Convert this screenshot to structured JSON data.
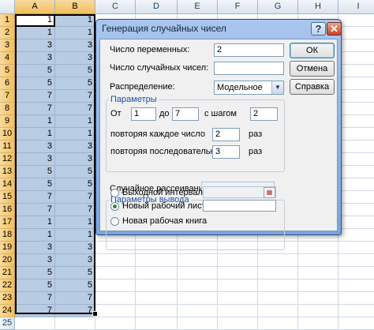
{
  "sheet": {
    "columns": [
      {
        "label": "A",
        "width": 51,
        "selected": true
      },
      {
        "label": "B",
        "width": 51,
        "selected": true
      },
      {
        "label": "C",
        "width": 51,
        "selected": false
      },
      {
        "label": "D",
        "width": 53,
        "selected": false
      },
      {
        "label": "E",
        "width": 51,
        "selected": false
      },
      {
        "label": "F",
        "width": 51,
        "selected": false
      },
      {
        "label": "G",
        "width": 51,
        "selected": false
      },
      {
        "label": "H",
        "width": 51,
        "selected": false
      },
      {
        "label": "I",
        "width": 51,
        "selected": false
      }
    ],
    "rows": [
      "1",
      "2",
      "3",
      "4",
      "5",
      "6",
      "7",
      "8",
      "9",
      "10",
      "11",
      "12",
      "13",
      "14",
      "15",
      "16",
      "17",
      "18",
      "19",
      "20",
      "21",
      "22",
      "23",
      "24",
      "25"
    ],
    "col_a": [
      "1",
      "1",
      "3",
      "3",
      "5",
      "5",
      "7",
      "7",
      "1",
      "1",
      "3",
      "3",
      "5",
      "5",
      "7",
      "7",
      "1",
      "1",
      "3",
      "3",
      "5",
      "5",
      "7",
      "7"
    ],
    "col_b": [
      "1",
      "1",
      "3",
      "3",
      "5",
      "5",
      "7",
      "7",
      "1",
      "1",
      "3",
      "3",
      "5",
      "5",
      "7",
      "7",
      "1",
      "1",
      "3",
      "3",
      "5",
      "5",
      "7",
      "7"
    ],
    "selection_color": "#b8cce4",
    "header_selected_color": "#f1c05a"
  },
  "dialog": {
    "title": "Генерация случайных чисел",
    "help_glyph": "?",
    "close_glyph": "✕",
    "num_variables_label": "Число переменных:",
    "num_variables_value": "2",
    "num_random_label": "Число случайных чисел:",
    "num_random_value": "",
    "distribution_label": "Распределение:",
    "distribution_value": "Модельное",
    "ok_label": "ОК",
    "cancel_label": "Отмена",
    "help_label": "Справка",
    "params_title": "Параметры",
    "from_label": "От",
    "from_value": "1",
    "to_label": "до",
    "to_value": "7",
    "step_label": "с шагом",
    "step_value": "2",
    "repeat_each_label": "повторяя каждое число",
    "repeat_each_value": "2",
    "repeat_each_unit": "раз",
    "repeat_seq_label": "повторяя последовательность",
    "repeat_seq_value": "3",
    "repeat_seq_unit": "раз",
    "seed_label": "Случайное рассеивание:",
    "seed_value": "",
    "output_title": "Параметры вывода",
    "output_range_label": "Выходной интервал:",
    "output_range_value": "",
    "new_sheet_label": "Новый рабочий лист:",
    "new_sheet_value": "",
    "new_book_label": "Новая рабочая книга",
    "selected_output": "new_sheet"
  }
}
